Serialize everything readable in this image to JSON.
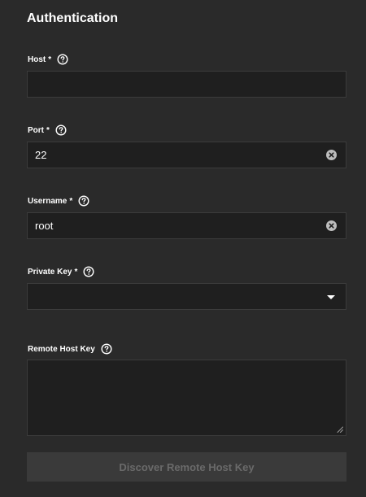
{
  "section": {
    "title": "Authentication"
  },
  "fields": {
    "host": {
      "label": "Host",
      "required_mark": "*",
      "value": ""
    },
    "port": {
      "label": "Port",
      "required_mark": "*",
      "value": "22"
    },
    "username": {
      "label": "Username",
      "required_mark": "*",
      "value": "root"
    },
    "private_key": {
      "label": "Private Key",
      "required_mark": "*",
      "selected": ""
    },
    "remote_host_key": {
      "label": "Remote Host Key",
      "value": ""
    }
  },
  "actions": {
    "discover_label": "Discover Remote Host Key",
    "discover_enabled": false
  },
  "icons": {
    "help": "help-circle-icon",
    "clear": "clear-circle-icon",
    "dropdown": "caret-down-icon",
    "resize": "resize-grip-icon"
  },
  "colors": {
    "background": "#2a2a2a",
    "input_background": "#1f1f1f",
    "input_border": "#3b3b3b",
    "text": "#ffffff",
    "button_background": "#3a3a3a",
    "button_text_disabled": "#6a6a6a"
  }
}
